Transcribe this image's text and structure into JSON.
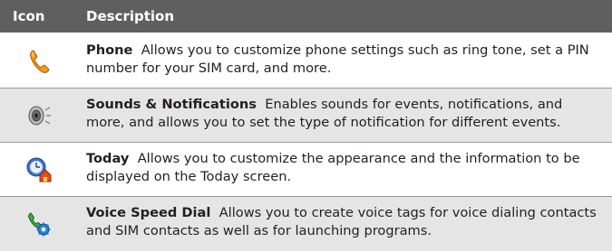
{
  "header": {
    "icon_col": "Icon",
    "desc_col": "Description"
  },
  "rows": [
    {
      "icon": "phone-icon",
      "title": "Phone",
      "description": "Allows you to customize phone settings such as ring tone, set a PIN number for your SIM card, and more."
    },
    {
      "icon": "speaker-icon",
      "title": "Sounds & Notifications",
      "description": "Enables sounds for events, notifications, and more, and allows you to set the type of notification for different events."
    },
    {
      "icon": "today-icon",
      "title": "Today",
      "description": "Allows you to customize the appearance and the information to be displayed on the Today screen."
    },
    {
      "icon": "voice-speed-dial-icon",
      "title": "Voice Speed Dial",
      "description": "Allows you to create voice tags for voice dialing contacts and SIM contacts as well as for launching programs."
    }
  ]
}
